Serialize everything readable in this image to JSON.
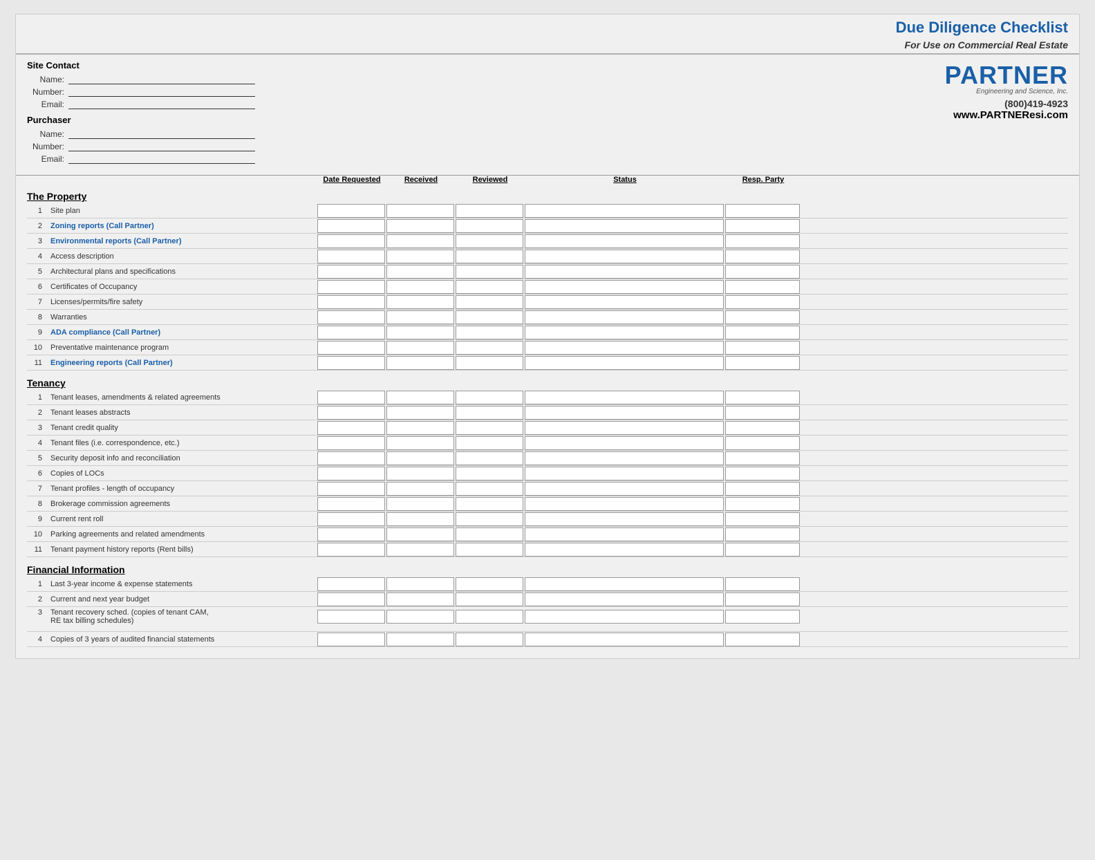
{
  "header": {
    "title": "Due Diligence Checklist",
    "subtitle": "For Use on Commercial Real Estate"
  },
  "logo": {
    "name_blue": "PARTNER",
    "name_gray": "",
    "sub": "Engineering and Science, Inc.",
    "phone": "(800)419-4923",
    "website": "www.PARTNEResi.com"
  },
  "site_contact": {
    "label": "Site Contact",
    "fields": [
      {
        "label": "Name:",
        "value": ""
      },
      {
        "label": "Number:",
        "value": ""
      },
      {
        "label": "Email:",
        "value": ""
      }
    ]
  },
  "purchaser": {
    "label": "Purchaser",
    "fields": [
      {
        "label": "Name:",
        "value": ""
      },
      {
        "label": "Number:",
        "value": ""
      },
      {
        "label": "Email:",
        "value": ""
      }
    ]
  },
  "columns": {
    "date_requested": "Date Requested",
    "received": "Received",
    "reviewed": "Reviewed",
    "status": "Status",
    "resp_party": "Resp. Party"
  },
  "sections": [
    {
      "title": "The Property",
      "items": [
        {
          "num": 1,
          "label": "Site plan",
          "blue": false
        },
        {
          "num": 2,
          "label": "Zoning reports (Call Partner)",
          "blue": true
        },
        {
          "num": 3,
          "label": "Environmental reports (Call Partner)",
          "blue": true
        },
        {
          "num": 4,
          "label": "Access description",
          "blue": false
        },
        {
          "num": 5,
          "label": "Architectural plans and specifications",
          "blue": false
        },
        {
          "num": 6,
          "label": "Certificates of Occupancy",
          "blue": false
        },
        {
          "num": 7,
          "label": "Licenses/permits/fire safety",
          "blue": false
        },
        {
          "num": 8,
          "label": "Warranties",
          "blue": false
        },
        {
          "num": 9,
          "label": "ADA compliance (Call Partner)",
          "blue": true
        },
        {
          "num": 10,
          "label": "Preventative maintenance program",
          "blue": false
        },
        {
          "num": 11,
          "label": "Engineering reports (Call Partner)",
          "blue": true
        }
      ]
    },
    {
      "title": "Tenancy",
      "items": [
        {
          "num": 1,
          "label": "Tenant leases, amendments & related agreements",
          "blue": false
        },
        {
          "num": 2,
          "label": "Tenant leases abstracts",
          "blue": false
        },
        {
          "num": 3,
          "label": "Tenant credit quality",
          "blue": false
        },
        {
          "num": 4,
          "label": "Tenant files (i.e. correspondence, etc.)",
          "blue": false
        },
        {
          "num": 5,
          "label": "Security deposit info and reconciliation",
          "blue": false
        },
        {
          "num": 6,
          "label": "Copies of LOCs",
          "blue": false
        },
        {
          "num": 7,
          "label": "Tenant profiles - length of occupancy",
          "blue": false
        },
        {
          "num": 8,
          "label": "Brokerage commission agreements",
          "blue": false
        },
        {
          "num": 9,
          "label": "Current rent roll",
          "blue": false
        },
        {
          "num": 10,
          "label": "Parking agreements and related amendments",
          "blue": false
        },
        {
          "num": 11,
          "label": "Tenant payment history reports (Rent bills)",
          "blue": false
        }
      ]
    },
    {
      "title": "Financial Information",
      "items": [
        {
          "num": 1,
          "label": "Last 3-year income & expense statements",
          "blue": false
        },
        {
          "num": 2,
          "label": "Current and next year budget",
          "blue": false
        },
        {
          "num": 3,
          "label": "Tenant recovery sched. (copies of tenant CAM,\nRE tax billing schedules)",
          "blue": false,
          "multiline": true
        },
        {
          "num": 4,
          "label": "Copies of 3 years of audited financial statements",
          "blue": false
        }
      ]
    }
  ]
}
